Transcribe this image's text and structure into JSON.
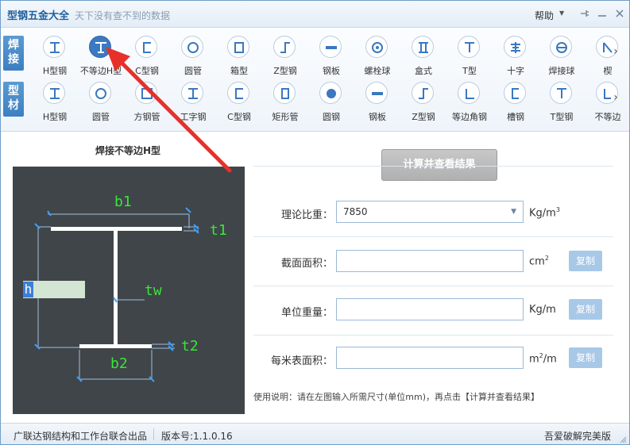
{
  "window": {
    "title": "型钢五金大全",
    "slogan": "天下没有查不到的数据",
    "help_label": "帮助"
  },
  "toolbar": {
    "row1_label": "焊接",
    "row2_label": "型材",
    "row1": [
      {
        "label": "H型钢",
        "icon": "i-beam"
      },
      {
        "label": "不等边H型",
        "icon": "unequal-i-beam"
      },
      {
        "label": "C型钢",
        "icon": "c-channel"
      },
      {
        "label": "圆管",
        "icon": "round-tube"
      },
      {
        "label": "箱型",
        "icon": "box-section"
      },
      {
        "label": "Z型钢",
        "icon": "z-section"
      },
      {
        "label": "钢板",
        "icon": "steel-plate"
      },
      {
        "label": "螺栓球",
        "icon": "bolt-ball"
      },
      {
        "label": "盒式",
        "icon": "box-type"
      },
      {
        "label": "T型",
        "icon": "t-section"
      },
      {
        "label": "十字",
        "icon": "cross-section"
      },
      {
        "label": "焊接球",
        "icon": "welded-ball"
      },
      {
        "label": "楔",
        "icon": "wedge"
      }
    ],
    "row2": [
      {
        "label": "H型钢",
        "icon": "i-beam"
      },
      {
        "label": "圆管",
        "icon": "round-tube"
      },
      {
        "label": "方钢管",
        "icon": "square-tube"
      },
      {
        "label": "工字钢",
        "icon": "i-beam"
      },
      {
        "label": "C型钢",
        "icon": "c-channel"
      },
      {
        "label": "矩形管",
        "icon": "rect-tube"
      },
      {
        "label": "圆钢",
        "icon": "round-bar"
      },
      {
        "label": "钢板",
        "icon": "steel-plate"
      },
      {
        "label": "Z型钢",
        "icon": "z-section"
      },
      {
        "label": "等边角钢",
        "icon": "equal-angle"
      },
      {
        "label": "槽钢",
        "icon": "channel"
      },
      {
        "label": "T型钢",
        "icon": "t-section"
      },
      {
        "label": "不等边",
        "icon": "unequal-angle"
      }
    ]
  },
  "figure": {
    "title": "焊接不等边H型",
    "labels": {
      "b1": "b1",
      "t1": "t1",
      "tw": "tw",
      "t2": "t2",
      "b2": "b2",
      "h": "h"
    }
  },
  "form": {
    "calc_button": "计算并查看结果",
    "density_label": "理论比重：",
    "density_value": "7850",
    "density_unit": "Kg/m",
    "density_unit_sup": "3",
    "area_label": "截面面积：",
    "area_unit": "cm",
    "area_unit_sup": "2",
    "weight_label": "单位重量：",
    "weight_unit": "Kg/m",
    "surface_label": "每米表面积：",
    "surface_unit_pre": "m",
    "surface_unit_sup": "2",
    "surface_unit_post": "/m",
    "copy_label": "复制",
    "usage": "使用说明：请在左图输入所需尺寸(单位mm)，再点击【计算并查看结果】"
  },
  "status": {
    "credits": "广联达钢结构和工作台联合出品",
    "version": "版本号:1.1.0.16",
    "right": "吾爱破解完美版"
  },
  "colors": {
    "accent": "#3b7ac2",
    "diagram_bg": "#404549",
    "dimension_green": "#39e639",
    "dimension_blue": "#3aa0ff",
    "arrow_red": "#e8302a"
  }
}
